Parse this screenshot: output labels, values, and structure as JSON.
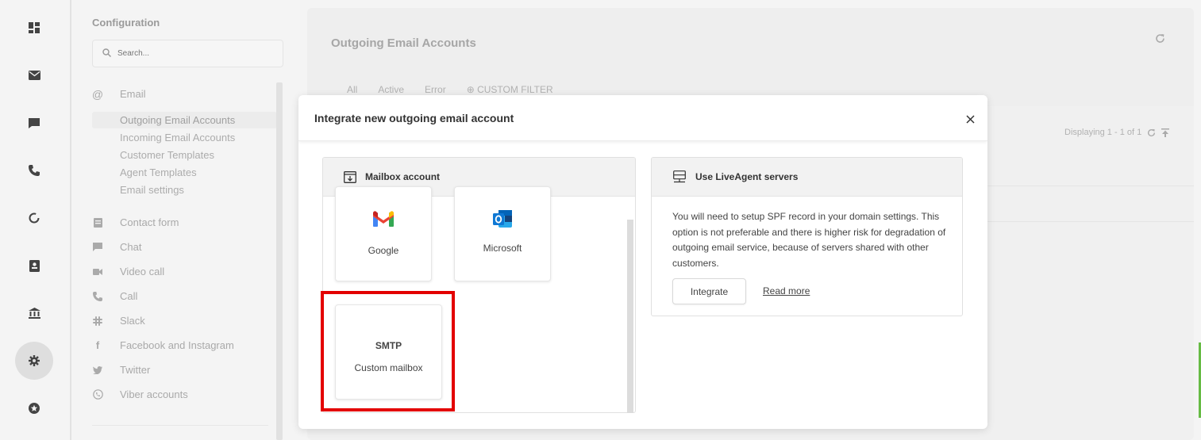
{
  "config": {
    "title": "Configuration",
    "search_placeholder": "Search...",
    "email_group": "Email",
    "email_items": [
      "Outgoing Email Accounts",
      "Incoming Email Accounts",
      "Customer Templates",
      "Agent Templates",
      "Email settings"
    ],
    "groups": [
      {
        "label": "Contact form",
        "icon": "form-icon"
      },
      {
        "label": "Chat",
        "icon": "chat-icon"
      },
      {
        "label": "Video call",
        "icon": "video-icon"
      },
      {
        "label": "Call",
        "icon": "phone-icon"
      },
      {
        "label": "Slack",
        "icon": "slack-icon"
      },
      {
        "label": "Facebook and Instagram",
        "icon": "facebook-icon"
      },
      {
        "label": "Twitter",
        "icon": "twitter-icon"
      },
      {
        "label": "Viber accounts",
        "icon": "viber-icon"
      }
    ]
  },
  "main": {
    "title": "Outgoing Email Accounts",
    "filters": [
      "All",
      "Active",
      "Error",
      "⊕ CUSTOM FILTER"
    ],
    "displaying": "Displaying 1 - 1 of 1"
  },
  "modal": {
    "title": "Integrate new outgoing email account",
    "mailbox": {
      "heading": "Mailbox account",
      "google_label": "Google",
      "microsoft_label": "Microsoft",
      "smtp_title": "SMTP",
      "smtp_label": "Custom mailbox"
    },
    "liveagent": {
      "heading": "Use LiveAgent servers",
      "description": "You will need to setup SPF record in your domain settings. This option is not preferable and there is higher risk for degradation of outgoing email service, because of servers shared with other customers.",
      "integrate_label": "Integrate",
      "read_more_label": "Read more"
    }
  },
  "colors": {
    "highlight": "#e30000",
    "accent_green": "#66bb44"
  }
}
